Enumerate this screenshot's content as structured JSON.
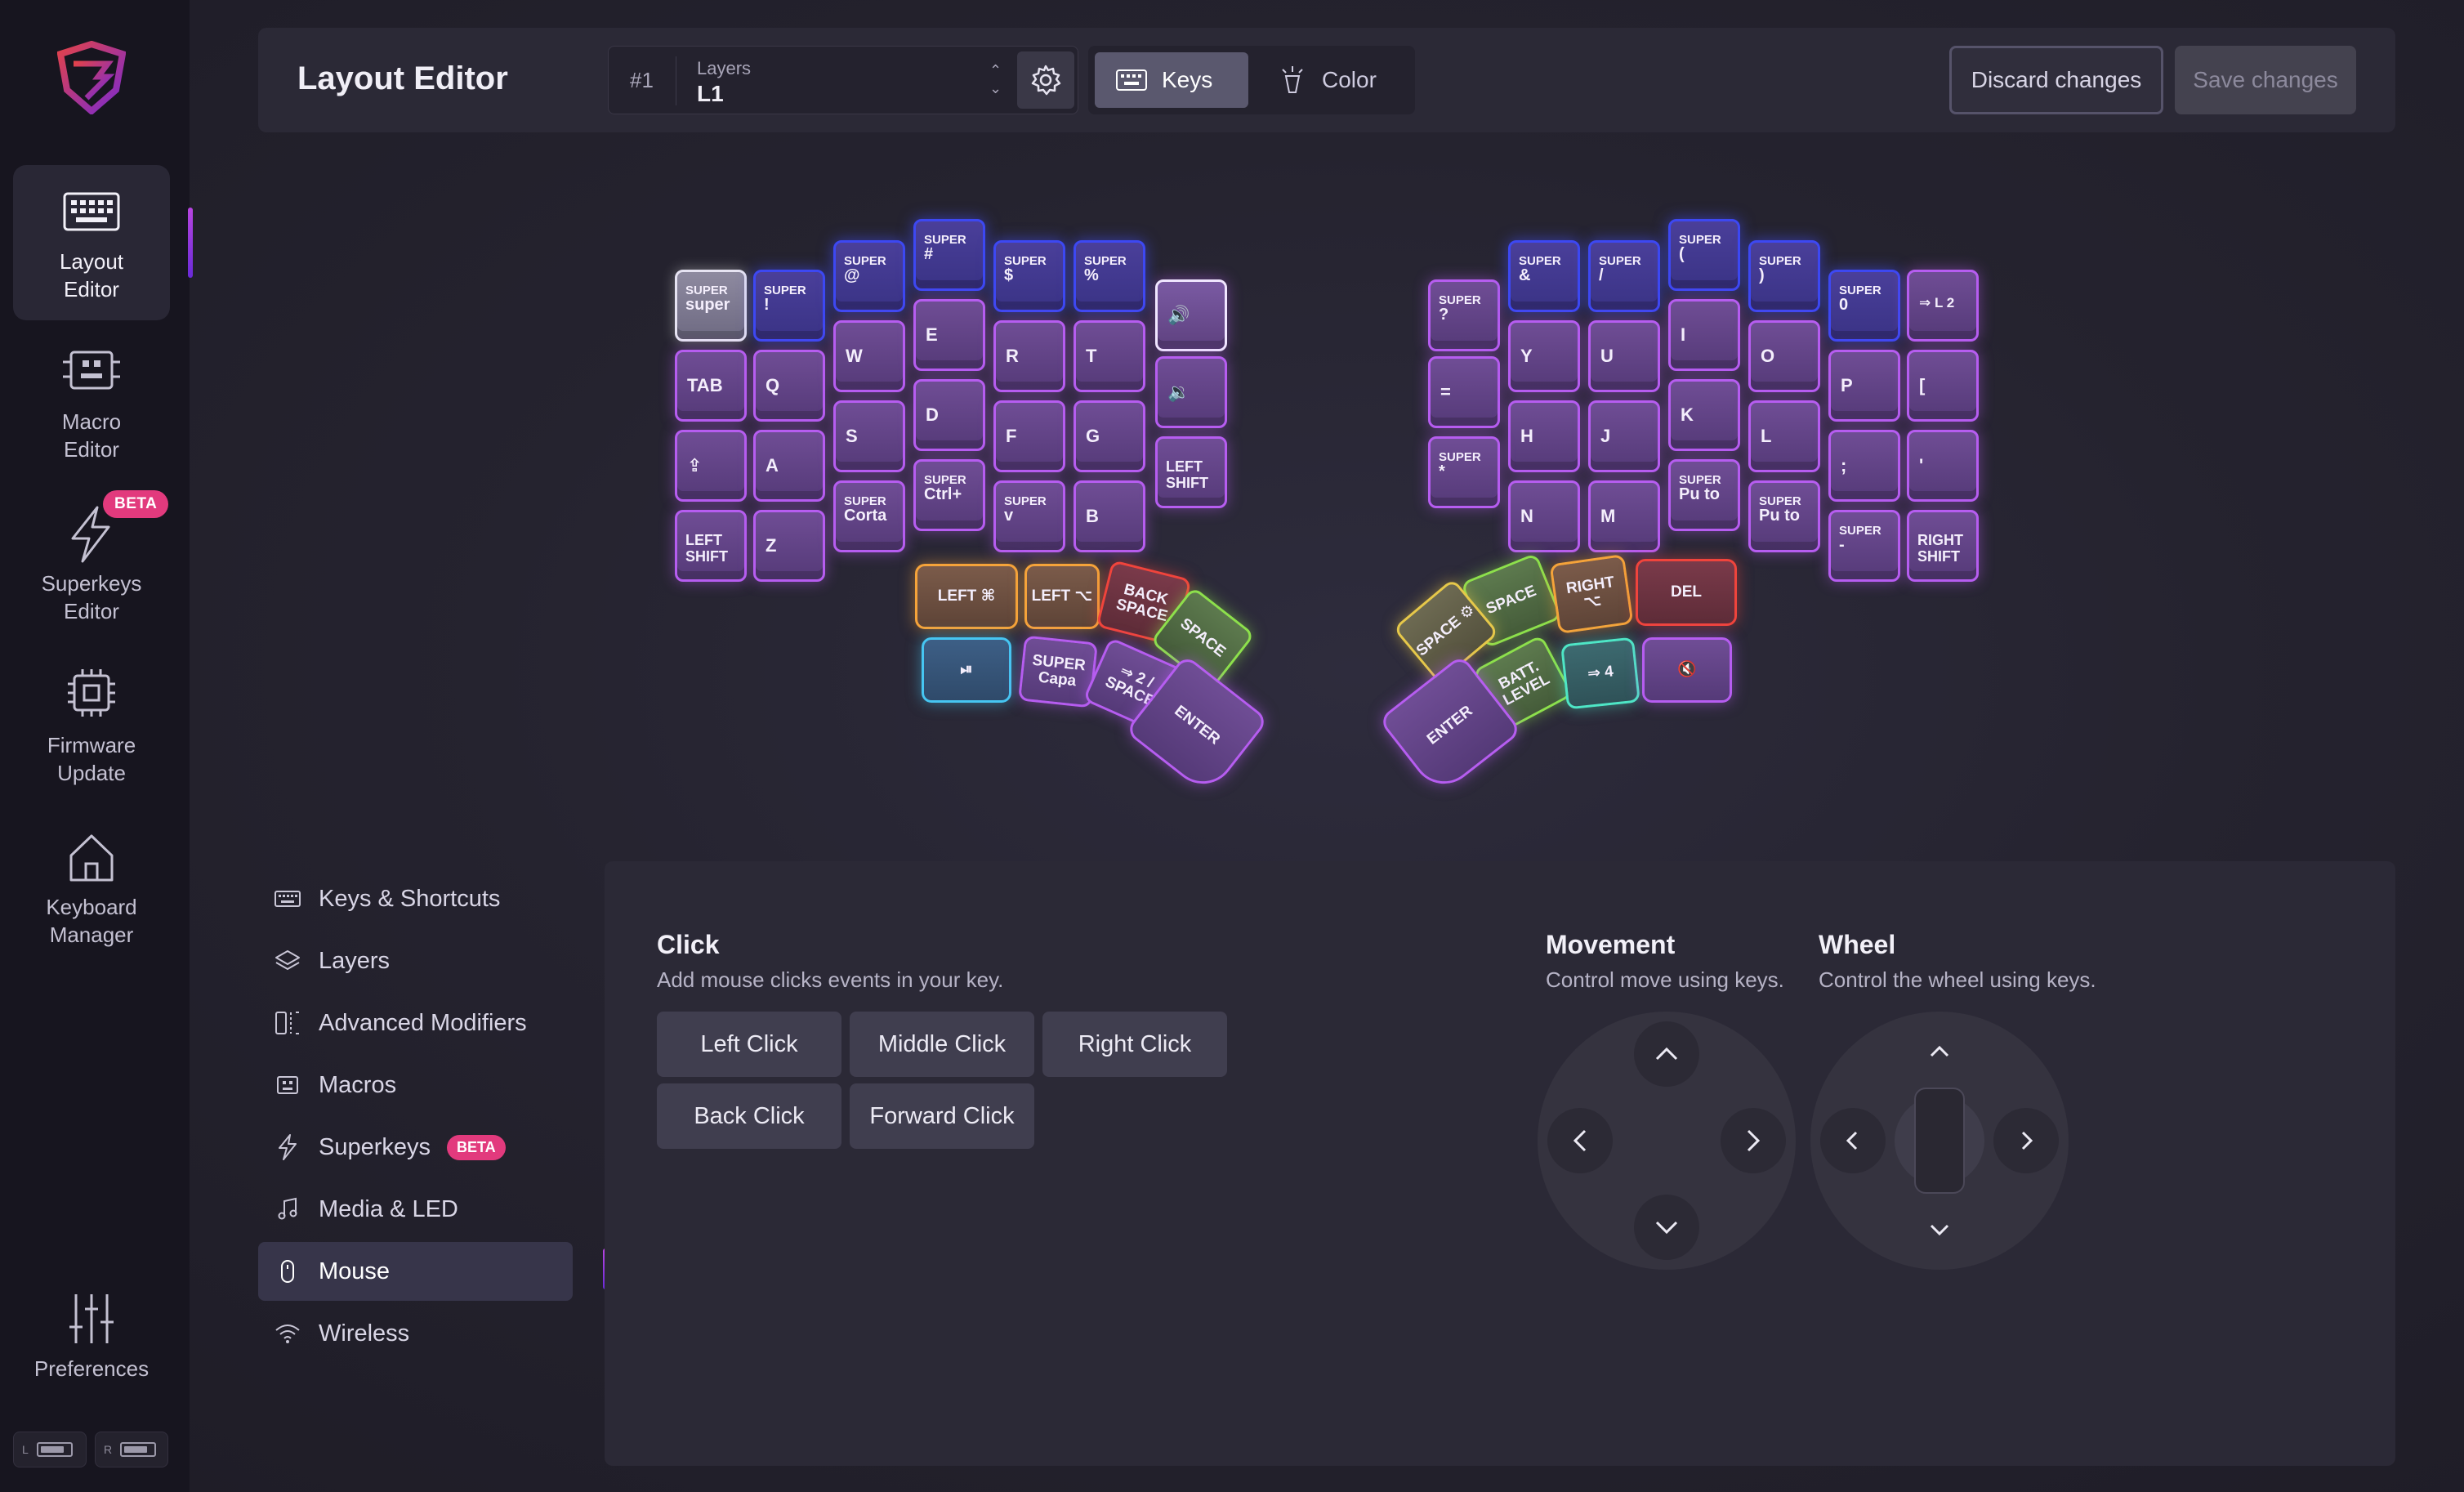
{
  "nav": {
    "items": [
      {
        "label": "Layout\nEditor",
        "icon": "keyboard-icon"
      },
      {
        "label": "Macro\nEditor",
        "icon": "macro-icon"
      },
      {
        "label": "Superkeys\nEditor",
        "icon": "bolt-icon",
        "badge": "BETA"
      },
      {
        "label": "Firmware\nUpdate",
        "icon": "chip-icon"
      },
      {
        "label": "Keyboard\nManager",
        "icon": "home-icon"
      },
      {
        "label": "Preferences",
        "icon": "sliders-icon"
      }
    ],
    "battery_left": "L",
    "battery_right": "R"
  },
  "header": {
    "title": "Layout Editor",
    "layer_number": "#1",
    "layer_caption": "Layers",
    "layer_value": "L1",
    "mode_keys": "Keys",
    "mode_color": "Color",
    "discard": "Discard changes",
    "save": "Save changes"
  },
  "keyboard": {
    "left": {
      "row0": [
        [
          "SUPER",
          "super"
        ],
        [
          "SUPER",
          "!"
        ],
        [
          "SUPER",
          "@"
        ],
        [
          "SUPER",
          "#"
        ],
        [
          "SUPER",
          "$"
        ],
        [
          "SUPER",
          "%"
        ]
      ],
      "row1": [
        "TAB",
        "Q",
        "W",
        "E",
        "R",
        "T"
      ],
      "row2": [
        "⇪",
        "A",
        "S",
        "D",
        "F",
        "G"
      ],
      "row3": [
        [
          "LEFT",
          "SHIFT"
        ],
        "Z",
        [
          "SUPER",
          "Corta"
        ],
        [
          "SUPER",
          "Ctrl+"
        ],
        [
          "SUPER",
          "v"
        ],
        "B"
      ],
      "extra": [
        "🔊",
        "🔉",
        [
          "LEFT",
          "SHIFT"
        ]
      ],
      "thumbs": [
        "LEFT ⌘",
        "LEFT ⌥",
        "BACK SPACE",
        "SPACE",
        "⏯",
        "SUPER Capa",
        "⇒ 2 / SPACE",
        "ENTER"
      ]
    },
    "right": {
      "row0": [
        [
          "SUPER",
          "?"
        ],
        [
          "SUPER",
          "&"
        ],
        [
          "SUPER",
          "/"
        ],
        [
          "SUPER",
          "("
        ],
        [
          "SUPER",
          ")"
        ],
        [
          "SUPER",
          "0"
        ],
        "⇒ L 2"
      ],
      "row1": [
        "=",
        "Y",
        "U",
        "I",
        "O",
        "P",
        "["
      ],
      "row2": [
        "H",
        "J",
        "K",
        "L",
        ";",
        "'"
      ],
      "row3": [
        [
          "SUPER",
          "*"
        ],
        "N",
        "M",
        [
          "SUPER",
          "Pu to"
        ],
        [
          "SUPER",
          "Pu to"
        ],
        [
          "SUPER",
          "-"
        ],
        [
          "RIGHT",
          "SHIFT"
        ]
      ],
      "thumbs": [
        "SPACE",
        "RIGHT ⌥",
        "DEL",
        "SPACE ⚙",
        "BATT. LEVEL",
        "⇒ 4",
        "🔇",
        "ENTER"
      ]
    }
  },
  "subnav": {
    "items": [
      {
        "label": "Keys & Shortcuts",
        "icon": "keyboard-icon"
      },
      {
        "label": "Layers",
        "icon": "layers-icon"
      },
      {
        "label": "Advanced Modifiers",
        "icon": "modifiers-icon"
      },
      {
        "label": "Macros",
        "icon": "macro-icon"
      },
      {
        "label": "Superkeys",
        "icon": "bolt-icon",
        "badge": "BETA"
      },
      {
        "label": "Media & LED",
        "icon": "media-icon"
      },
      {
        "label": "Mouse",
        "icon": "mouse-icon"
      },
      {
        "label": "Wireless",
        "icon": "wifi-icon"
      }
    ]
  },
  "panel": {
    "click_title": "Click",
    "click_desc": "Add mouse clicks events in your key.",
    "clicks": [
      "Left Click",
      "Middle Click",
      "Right Click",
      "Back Click",
      "Forward Click"
    ],
    "movement_title": "Movement",
    "movement_desc": "Control move using keys.",
    "wheel_title": "Wheel",
    "wheel_desc": "Control the wheel using keys."
  },
  "colors": {
    "accent": "#b65df0",
    "beta": "#e23a7d",
    "blue_key": "#3d48f2"
  }
}
